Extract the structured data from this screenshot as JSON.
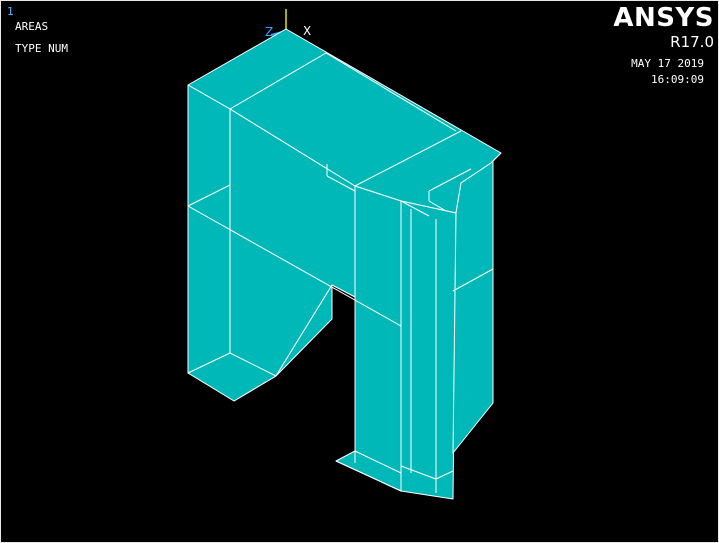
{
  "window": {
    "number": "1"
  },
  "plot_labels": {
    "entity": "AREAS",
    "numbering": "TYPE NUM"
  },
  "branding": {
    "product": "ANSYS",
    "release": "R17.0"
  },
  "timestamp": {
    "date": "MAY 17 2019",
    "time": "16:09:09"
  },
  "triad": {
    "x_label": "X",
    "z_label": "Z",
    "y_color": "#e6e600",
    "x_color": "#ffffff",
    "z_color": "#3aa0ff"
  },
  "colors": {
    "background": "#000000",
    "area_fill": "#00b8b8",
    "edge": "#ffffff"
  }
}
